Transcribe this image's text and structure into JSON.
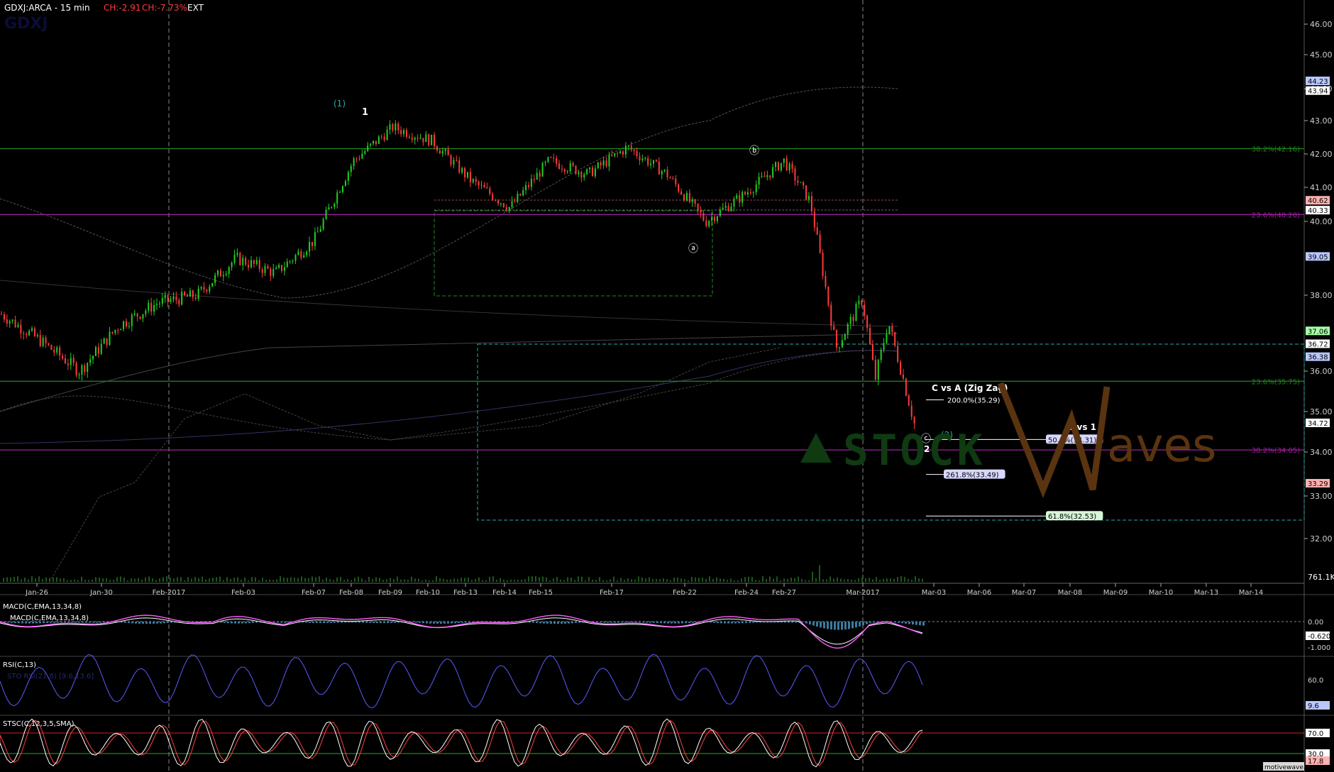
{
  "header": {
    "symbol_label": "GDXJ:ARCA - 15 min",
    "change_abs": "CH:-2.91",
    "change_pct": "CH:-7.73%",
    "session": "EXT",
    "watermark_ticker": "GDXJ"
  },
  "footer": {
    "site": "motivewave.com"
  },
  "colors": {
    "up": "#1fd11f",
    "down": "#ff3b3b",
    "fib_green": "#1f8a1f",
    "fib_purple": "#a020a0",
    "cyan": "#29a8a8",
    "macd_line": "#ff5cff",
    "macd_signal": "#ffffff",
    "rsi_line": "#5a5aff",
    "stoch_k": "#ffffff",
    "stoch_d": "#ff4040"
  },
  "chart_data": [
    {
      "type": "line",
      "panel": "price",
      "ylim": [
        31,
        46.3
      ],
      "yticks": [
        "46.00",
        "45.00",
        "44.00",
        "43.00",
        "42.00",
        "41.00",
        "40.00",
        "38.00",
        "36.00",
        "35.00",
        "34.00",
        "33.00",
        "32.00"
      ],
      "ytick_values": [
        46,
        45,
        44,
        43,
        42,
        41,
        40,
        38,
        36,
        35,
        34,
        33,
        32
      ],
      "x_labels": [
        "Jan-26",
        "Jan-30",
        "Feb-2017",
        "Feb-03",
        "Feb-07",
        "Feb-08",
        "Feb-09",
        "Feb-10",
        "Feb-13",
        "Feb-14",
        "Feb-15",
        "Feb-17",
        "Feb-22",
        "Feb-24",
        "Feb-27",
        "Mar-2017",
        "Mar-03",
        "Mar-06",
        "Mar-07",
        "Mar-08",
        "Mar-09",
        "Mar-10",
        "Mar-13",
        "Mar-14"
      ],
      "series": [
        {
          "name": "GDXJ",
          "x": [
            0,
            0.03,
            0.06,
            0.09,
            0.12,
            0.15,
            0.18,
            0.21,
            0.24,
            0.27,
            0.3,
            0.33,
            0.36,
            0.39,
            0.42,
            0.45,
            0.48,
            0.51,
            0.54,
            0.57,
            0.6,
            0.62,
            0.64,
            0.66,
            0.67,
            0.68,
            0.7
          ],
          "values": [
            37.5,
            36.8,
            36.0,
            37.2,
            37.8,
            38.0,
            39.0,
            38.6,
            39.5,
            41.8,
            42.8,
            42.4,
            41.2,
            40.4,
            41.8,
            41.4,
            42.2,
            41.4,
            40.0,
            40.8,
            41.8,
            40.6,
            36.6,
            37.9,
            35.8,
            37.3,
            34.7
          ]
        }
      ],
      "fib_levels": [
        {
          "label": "38.2%(42.16)",
          "value": 42.16,
          "color": "green"
        },
        {
          "label": "23.6%(40.20)",
          "value": 40.2,
          "color": "purple"
        },
        {
          "label": "23.6%(35.75)",
          "value": 35.75,
          "color": "green"
        },
        {
          "label": "38.2%(34.05)",
          "value": 34.05,
          "color": "purple"
        }
      ],
      "projections": [
        {
          "label": "200.0%(35.29)",
          "value": 35.29
        },
        {
          "label": "50.0%(34.31)",
          "value": 34.31
        },
        {
          "label": "261.8%(33.49)",
          "value": 33.49
        },
        {
          "label": "61.8%(32.53)",
          "value": 32.53
        }
      ],
      "annotations": {
        "wave_1_paren": "(1)",
        "wave_1": "1",
        "wave_b": "ⓑ",
        "wave_a": "ⓐ",
        "wave_c": "ⓒ",
        "wave_2": "2",
        "wave_2_paren": "(2)",
        "c_vs_a": "C vs A (Zig Zag)",
        "two_vs_one": "2 vs 1"
      },
      "price_tags": [
        "44.23",
        "43.94",
        "40.62",
        "40.33",
        "39.05",
        "37.06",
        "36.72",
        "36.38",
        "34.72",
        "33.29"
      ],
      "volume_tag": "761.1K",
      "logo_left": "STOCK",
      "logo_right": "aves"
    },
    {
      "type": "line",
      "panel": "macd",
      "title": "MACD(C,EMA,13,34,8)",
      "subtitle": "MACD(C,EMA,13,34,8)",
      "yticks": [
        "0.00",
        "-0.620",
        "-1.000"
      ],
      "ytick_values": [
        0,
        -0.62,
        -1.0
      ]
    },
    {
      "type": "line",
      "panel": "rsi",
      "title": "RSI(C,13)",
      "subtitle": "STO RSI(21,8) [9.6,13.6]",
      "yticks": [
        "60.0",
        "9.6"
      ],
      "ytick_values": [
        60,
        9.6
      ]
    },
    {
      "type": "line",
      "panel": "stoch",
      "title": "STSC(C,12,3,5,SMA)",
      "yticks": [
        "70.0",
        "30.0",
        "17.8"
      ],
      "ytick_values": [
        70,
        30,
        17.8
      ]
    }
  ]
}
